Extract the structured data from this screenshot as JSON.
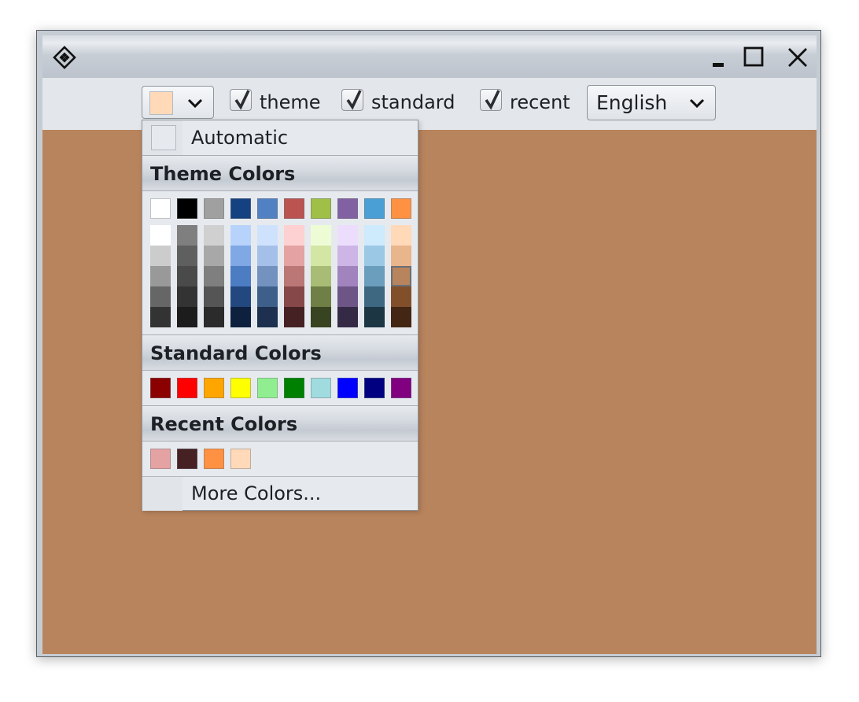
{
  "window": {
    "icons": {
      "app": "diamond-logo-icon",
      "minimize": "minimize-icon",
      "maximize": "maximize-icon",
      "close": "close-icon"
    }
  },
  "toolbar": {
    "color_combo": {
      "selected_color": "#ffd9b8",
      "icon": "chevron-down-icon"
    },
    "checkboxes": [
      {
        "label": "theme",
        "checked": true
      },
      {
        "label": "standard",
        "checked": true
      },
      {
        "label": "recent",
        "checked": true
      }
    ],
    "language": {
      "selected": "English",
      "icon": "chevron-down-icon"
    }
  },
  "content": {
    "background": "#b8845d"
  },
  "popup": {
    "automatic_label": "Automatic",
    "theme_header": "Theme Colors",
    "theme_base": [
      "#ffffff",
      "#000000",
      "#a0a0a0",
      "#14417f",
      "#5181c2",
      "#bb5450",
      "#9fbf46",
      "#8261a2",
      "#4a9fd4",
      "#ff9142"
    ],
    "theme_shades": [
      [
        "#ffffff",
        "#cccccc",
        "#999999",
        "#666666",
        "#333333"
      ],
      [
        "#7f7f7f",
        "#5f5f5f",
        "#4a4a4a",
        "#333333",
        "#1c1c1c"
      ],
      [
        "#d0d0d0",
        "#a8a8a8",
        "#7f7f7f",
        "#555555",
        "#2b2b2b"
      ],
      [
        "#b8d3fb",
        "#80a8e4",
        "#4c7cc2",
        "#23487f",
        "#0d213f"
      ],
      [
        "#cfe2fd",
        "#a4bfe8",
        "#7392c0",
        "#3f5f8b",
        "#1d3050"
      ],
      [
        "#fdd1d1",
        "#e5a2a2",
        "#bb7676",
        "#87484a",
        "#452124"
      ],
      [
        "#eefcd6",
        "#d3e6a3",
        "#a8bc76",
        "#6f7f45",
        "#384321"
      ],
      [
        "#edddfd",
        "#cdb5e5",
        "#a184bd",
        "#6d5586",
        "#352a46"
      ],
      [
        "#ceeafd",
        "#9bc8e4",
        "#6b9dbc",
        "#3e6882",
        "#1d3644"
      ],
      [
        "#ffd9b8",
        "#e8b58c",
        "#b8845d",
        "#81502a",
        "#432613"
      ]
    ],
    "selected_shade": {
      "column": 9,
      "row": 2
    },
    "standard_header": "Standard Colors",
    "standard_colors": [
      "#8b0000",
      "#ff0000",
      "#ffa500",
      "#ffff00",
      "#90ee90",
      "#008000",
      "#a0dcdf",
      "#0000ff",
      "#000080",
      "#800080"
    ],
    "recent_header": "Recent Colors",
    "recent_colors": [
      "#e5a2a2",
      "#452124",
      "#ff9142",
      "#ffd9b8"
    ],
    "more_label": "More Colors..."
  }
}
